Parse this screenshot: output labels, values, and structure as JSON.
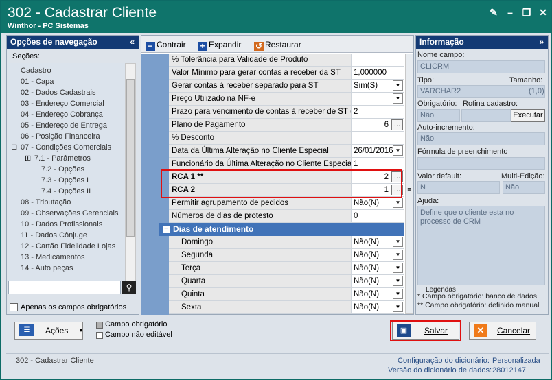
{
  "window": {
    "title": "302 - Cadastrar Cliente",
    "subtitle": "Winthor - PC Sistemas"
  },
  "nav": {
    "header": "Opções de navegação",
    "sections_label": "Seções:",
    "only_required_label": "Apenas os campos obrigatórios",
    "tree": [
      "Cadastro",
      "01 - Capa",
      "02 - Dados Cadastrais",
      "03 - Endereço Comercial",
      "04 - Endereço Cobrança",
      "05 - Endereço de Entrega",
      "06 - Posição Financeira",
      "07 - Condições Comerciais",
      "7.1 - Parâmetros",
      "7.2 - Opções",
      "7.3 - Opções I",
      "7.4 - Opções II",
      "08 - Tributação",
      "09 - Observações Gerenciais",
      "10 - Dados Profissionais",
      "11 - Dados Cônjuge",
      "12 - Cartão Fidelidade Lojas",
      "13 - Medicamentos",
      "14 - Auto peças"
    ]
  },
  "toolbar": {
    "collapse": "Contrair",
    "expand": "Expandir",
    "restore": "Restaurar"
  },
  "grid": {
    "rows": [
      {
        "label": "% Tolerância para Validade de Produto",
        "value": ""
      },
      {
        "label": "Valor Mínimo para gerar contas a receber da ST",
        "value": "1,000000"
      },
      {
        "label": "Gerar contas à receber separado para ST",
        "value": "Sim(S)"
      },
      {
        "label": "Preço Utilizado na NF-e",
        "value": ""
      },
      {
        "label": "Prazo para vencimento de contas à receber de ST (Dias)",
        "value": "2"
      },
      {
        "label": "Plano de Pagamento",
        "value": "6"
      },
      {
        "label": "% Desconto",
        "value": ""
      },
      {
        "label": "Data da Última Alteração no Cliente Especial",
        "value": "26/01/2016"
      },
      {
        "label": "Funcionário da Última Alteração no Cliente Especial",
        "value": "1"
      },
      {
        "label": "RCA 1 **",
        "value": "2"
      },
      {
        "label": "RCA 2",
        "value": "1"
      },
      {
        "label": "Permitir agrupamento de pedidos",
        "value": "Não(N)"
      },
      {
        "label": "Números de dias de protesto",
        "value": "0"
      }
    ],
    "section": "Dias de atendimento",
    "days": [
      {
        "label": "Domingo",
        "value": "Não(N)"
      },
      {
        "label": "Segunda",
        "value": "Não(N)"
      },
      {
        "label": "Terça",
        "value": "Não(N)"
      },
      {
        "label": "Quarta",
        "value": "Não(N)"
      },
      {
        "label": "Quinta",
        "value": "Não(N)"
      },
      {
        "label": "Sexta",
        "value": "Não(N)"
      }
    ]
  },
  "info": {
    "header": "Informação",
    "field_name_label": "Nome campo:",
    "field_name": "CLICRM",
    "type_label": "Tipo:",
    "size_label": "Tamanho:",
    "type": "VARCHAR2",
    "size": "(1,0)",
    "required_label": "Obrigatório:",
    "routine_label": "Rotina cadastro:",
    "required": "Não",
    "execute": "Executar",
    "autoinc_label": "Auto-incremento:",
    "autoinc": "Não",
    "formula_label": "Fórmula de preenchimento",
    "default_label": "Valor default:",
    "multi_label": "Multi-Edição:",
    "default": "N",
    "multi": "Não",
    "help_label": "Ajuda:",
    "help": "Define que o cliente esta no processo de CRM",
    "legend_title": "Legendas",
    "legend1": "* Campo obrigatório: banco de dados",
    "legend2": "** Campo obrigatório: definido manual"
  },
  "bottom": {
    "actions": "Ações",
    "required_field": "Campo obrigatório",
    "non_editable": "Campo não editável",
    "save": "Salvar",
    "cancel": "Cancelar"
  },
  "status": {
    "left": "302 - Cadastrar Cliente",
    "config_label": "Configuração do dicionário:",
    "config_value": "Personalizada",
    "version_label": "Versão do dicionário de dados:",
    "version_value": "28012147"
  }
}
